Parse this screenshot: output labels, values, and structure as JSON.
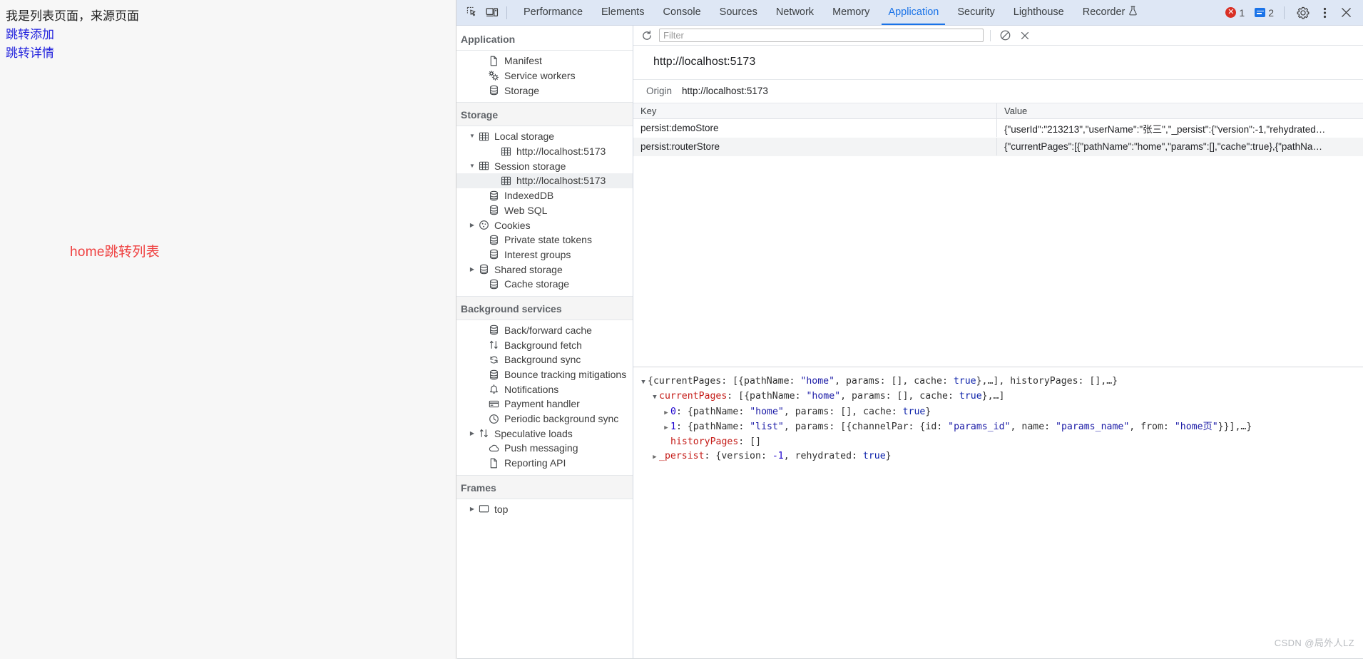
{
  "page": {
    "heading": "我是列表页面，来源页面",
    "links": [
      {
        "label": "跳转添加",
        "name": "jump-add-link"
      },
      {
        "label": "跳转详情",
        "name": "jump-detail-link"
      }
    ],
    "red_note": "home跳转列表",
    "colors": {
      "link": "#2222dd",
      "red": "#ef4040",
      "bg": "#f7f7f7"
    }
  },
  "devtools": {
    "tabs": [
      {
        "label": "Performance",
        "active": false
      },
      {
        "label": "Elements",
        "active": false
      },
      {
        "label": "Console",
        "active": false
      },
      {
        "label": "Sources",
        "active": false
      },
      {
        "label": "Network",
        "active": false
      },
      {
        "label": "Memory",
        "active": false
      },
      {
        "label": "Application",
        "active": true
      },
      {
        "label": "Security",
        "active": false
      },
      {
        "label": "Lighthouse",
        "active": false
      },
      {
        "label": "Recorder",
        "active": false
      }
    ],
    "toolbar_icons": {
      "inspect": "inspect-element-icon",
      "device": "device-toolbar-icon",
      "recorder_flask": "flask-icon",
      "settings": "gear-icon",
      "more": "kebab-menu-icon",
      "close": "close-icon"
    },
    "badges": {
      "errors": "1",
      "warnings": "2"
    },
    "accent": "#1a73e8",
    "error_color": "#d93025"
  },
  "sidebar": {
    "sections": [
      {
        "title": "Application",
        "items": [
          {
            "label": "Manifest",
            "icon": "document-icon",
            "twisty": "",
            "indent": 1,
            "selected": false
          },
          {
            "label": "Service workers",
            "icon": "gears-icon",
            "twisty": "",
            "indent": 1,
            "selected": false
          },
          {
            "label": "Storage",
            "icon": "database-icon",
            "twisty": "",
            "indent": 1,
            "selected": false
          }
        ]
      },
      {
        "title": "Storage",
        "items": [
          {
            "label": "Local storage",
            "icon": "table-icon",
            "twisty": "▼",
            "indent": 0,
            "selected": false
          },
          {
            "label": "http://localhost:5173",
            "icon": "table-icon",
            "twisty": "",
            "indent": 2,
            "selected": false
          },
          {
            "label": "Session storage",
            "icon": "table-icon",
            "twisty": "▼",
            "indent": 0,
            "selected": false
          },
          {
            "label": "http://localhost:5173",
            "icon": "table-icon",
            "twisty": "",
            "indent": 2,
            "selected": true
          },
          {
            "label": "IndexedDB",
            "icon": "database-icon",
            "twisty": "",
            "indent": 1,
            "selected": false
          },
          {
            "label": "Web SQL",
            "icon": "database-icon",
            "twisty": "",
            "indent": 1,
            "selected": false
          },
          {
            "label": "Cookies",
            "icon": "cookie-icon",
            "twisty": "▶",
            "indent": 0,
            "selected": false
          },
          {
            "label": "Private state tokens",
            "icon": "database-icon",
            "twisty": "",
            "indent": 1,
            "selected": false
          },
          {
            "label": "Interest groups",
            "icon": "database-icon",
            "twisty": "",
            "indent": 1,
            "selected": false
          },
          {
            "label": "Shared storage",
            "icon": "database-icon",
            "twisty": "▶",
            "indent": 0,
            "selected": false
          },
          {
            "label": "Cache storage",
            "icon": "database-icon",
            "twisty": "",
            "indent": 1,
            "selected": false
          }
        ]
      },
      {
        "title": "Background services",
        "items": [
          {
            "label": "Back/forward cache",
            "icon": "database-icon",
            "twisty": "",
            "indent": 1,
            "selected": false
          },
          {
            "label": "Background fetch",
            "icon": "arrows-updown-icon",
            "twisty": "",
            "indent": 1,
            "selected": false
          },
          {
            "label": "Background sync",
            "icon": "sync-icon",
            "twisty": "",
            "indent": 1,
            "selected": false
          },
          {
            "label": "Bounce tracking mitigations",
            "icon": "database-icon",
            "twisty": "",
            "indent": 1,
            "selected": false
          },
          {
            "label": "Notifications",
            "icon": "bell-icon",
            "twisty": "",
            "indent": 1,
            "selected": false
          },
          {
            "label": "Payment handler",
            "icon": "credit-card-icon",
            "twisty": "",
            "indent": 1,
            "selected": false
          },
          {
            "label": "Periodic background sync",
            "icon": "clock-icon",
            "twisty": "",
            "indent": 1,
            "selected": false
          },
          {
            "label": "Speculative loads",
            "icon": "arrows-updown-icon",
            "twisty": "▶",
            "indent": 0,
            "selected": false
          },
          {
            "label": "Push messaging",
            "icon": "cloud-icon",
            "twisty": "",
            "indent": 1,
            "selected": false
          },
          {
            "label": "Reporting API",
            "icon": "document-icon",
            "twisty": "",
            "indent": 1,
            "selected": false
          }
        ]
      },
      {
        "title": "Frames",
        "items": [
          {
            "label": "top",
            "icon": "frame-icon",
            "twisty": "▶",
            "indent": 0,
            "selected": false
          }
        ]
      }
    ]
  },
  "main": {
    "filter": {
      "placeholder": "Filter",
      "value": ""
    },
    "filter_icons": {
      "refresh": "refresh-icon",
      "clear_all": "clear-all-icon",
      "delete": "delete-selected-icon"
    },
    "origin_title": "http://localhost:5173",
    "origin_label": "Origin",
    "origin_value": "http://localhost:5173",
    "table": {
      "columns": [
        "Key",
        "Value"
      ],
      "rows": [
        {
          "key": "persist:demoStore",
          "value": "{\"userId\":\"213213\",\"userName\":\"张三\",\"_persist\":{\"version\":-1,\"rehydrated…"
        },
        {
          "key": "persist:routerStore",
          "value": "{\"currentPages\":[{\"pathName\":\"home\",\"params\":[],\"cache\":true},{\"pathNa…"
        }
      ]
    },
    "preview": {
      "lines": [
        {
          "indent": 0,
          "twisty": "▼",
          "segments": [
            {
              "t": "{",
              "c": "j-punc"
            },
            {
              "t": "currentPages",
              "c": "j-plain"
            },
            {
              "t": ": [{",
              "c": "j-punc"
            },
            {
              "t": "pathName",
              "c": "j-plain"
            },
            {
              "t": ": ",
              "c": "j-punc"
            },
            {
              "t": "\"home\"",
              "c": "j-str"
            },
            {
              "t": ", ",
              "c": "j-punc"
            },
            {
              "t": "params",
              "c": "j-plain"
            },
            {
              "t": ": [], ",
              "c": "j-punc"
            },
            {
              "t": "cache",
              "c": "j-plain"
            },
            {
              "t": ": ",
              "c": "j-punc"
            },
            {
              "t": "true",
              "c": "j-bool"
            },
            {
              "t": "},…], ",
              "c": "j-punc"
            },
            {
              "t": "historyPages",
              "c": "j-plain"
            },
            {
              "t": ": [],…}",
              "c": "j-punc"
            }
          ]
        },
        {
          "indent": 1,
          "twisty": "▼",
          "segments": [
            {
              "t": "currentPages",
              "c": "j-keyr"
            },
            {
              "t": ": [{",
              "c": "j-punc"
            },
            {
              "t": "pathName",
              "c": "j-plain"
            },
            {
              "t": ": ",
              "c": "j-punc"
            },
            {
              "t": "\"home\"",
              "c": "j-str"
            },
            {
              "t": ", ",
              "c": "j-punc"
            },
            {
              "t": "params",
              "c": "j-plain"
            },
            {
              "t": ": [], ",
              "c": "j-punc"
            },
            {
              "t": "cache",
              "c": "j-plain"
            },
            {
              "t": ": ",
              "c": "j-punc"
            },
            {
              "t": "true",
              "c": "j-bool"
            },
            {
              "t": "},…]",
              "c": "j-punc"
            }
          ]
        },
        {
          "indent": 2,
          "twisty": "▶",
          "segments": [
            {
              "t": "0",
              "c": "j-num"
            },
            {
              "t": ": {",
              "c": "j-punc"
            },
            {
              "t": "pathName",
              "c": "j-plain"
            },
            {
              "t": ": ",
              "c": "j-punc"
            },
            {
              "t": "\"home\"",
              "c": "j-str"
            },
            {
              "t": ", ",
              "c": "j-punc"
            },
            {
              "t": "params",
              "c": "j-plain"
            },
            {
              "t": ": [], ",
              "c": "j-punc"
            },
            {
              "t": "cache",
              "c": "j-plain"
            },
            {
              "t": ": ",
              "c": "j-punc"
            },
            {
              "t": "true",
              "c": "j-bool"
            },
            {
              "t": "}",
              "c": "j-punc"
            }
          ]
        },
        {
          "indent": 2,
          "twisty": "▶",
          "segments": [
            {
              "t": "1",
              "c": "j-num"
            },
            {
              "t": ": {",
              "c": "j-punc"
            },
            {
              "t": "pathName",
              "c": "j-plain"
            },
            {
              "t": ": ",
              "c": "j-punc"
            },
            {
              "t": "\"list\"",
              "c": "j-str"
            },
            {
              "t": ", ",
              "c": "j-punc"
            },
            {
              "t": "params",
              "c": "j-plain"
            },
            {
              "t": ": [{",
              "c": "j-punc"
            },
            {
              "t": "channelPar",
              "c": "j-plain"
            },
            {
              "t": ": {",
              "c": "j-punc"
            },
            {
              "t": "id",
              "c": "j-plain"
            },
            {
              "t": ": ",
              "c": "j-punc"
            },
            {
              "t": "\"params_id\"",
              "c": "j-str"
            },
            {
              "t": ", ",
              "c": "j-punc"
            },
            {
              "t": "name",
              "c": "j-plain"
            },
            {
              "t": ": ",
              "c": "j-punc"
            },
            {
              "t": "\"params_name\"",
              "c": "j-str"
            },
            {
              "t": ", ",
              "c": "j-punc"
            },
            {
              "t": "from",
              "c": "j-plain"
            },
            {
              "t": ": ",
              "c": "j-punc"
            },
            {
              "t": "\"home页\"",
              "c": "j-str"
            },
            {
              "t": "}}],…}",
              "c": "j-punc"
            }
          ]
        },
        {
          "indent": 2,
          "twisty": "",
          "segments": [
            {
              "t": "historyPages",
              "c": "j-keyr"
            },
            {
              "t": ": []",
              "c": "j-punc"
            }
          ]
        },
        {
          "indent": 1,
          "twisty": "▶",
          "segments": [
            {
              "t": "_persist",
              "c": "j-keyr"
            },
            {
              "t": ": {",
              "c": "j-punc"
            },
            {
              "t": "version",
              "c": "j-plain"
            },
            {
              "t": ": ",
              "c": "j-punc"
            },
            {
              "t": "-1",
              "c": "j-num"
            },
            {
              "t": ", ",
              "c": "j-punc"
            },
            {
              "t": "rehydrated",
              "c": "j-plain"
            },
            {
              "t": ": ",
              "c": "j-punc"
            },
            {
              "t": "true",
              "c": "j-bool"
            },
            {
              "t": "}",
              "c": "j-punc"
            }
          ]
        }
      ]
    }
  },
  "watermark": "CSDN @局外人LZ"
}
